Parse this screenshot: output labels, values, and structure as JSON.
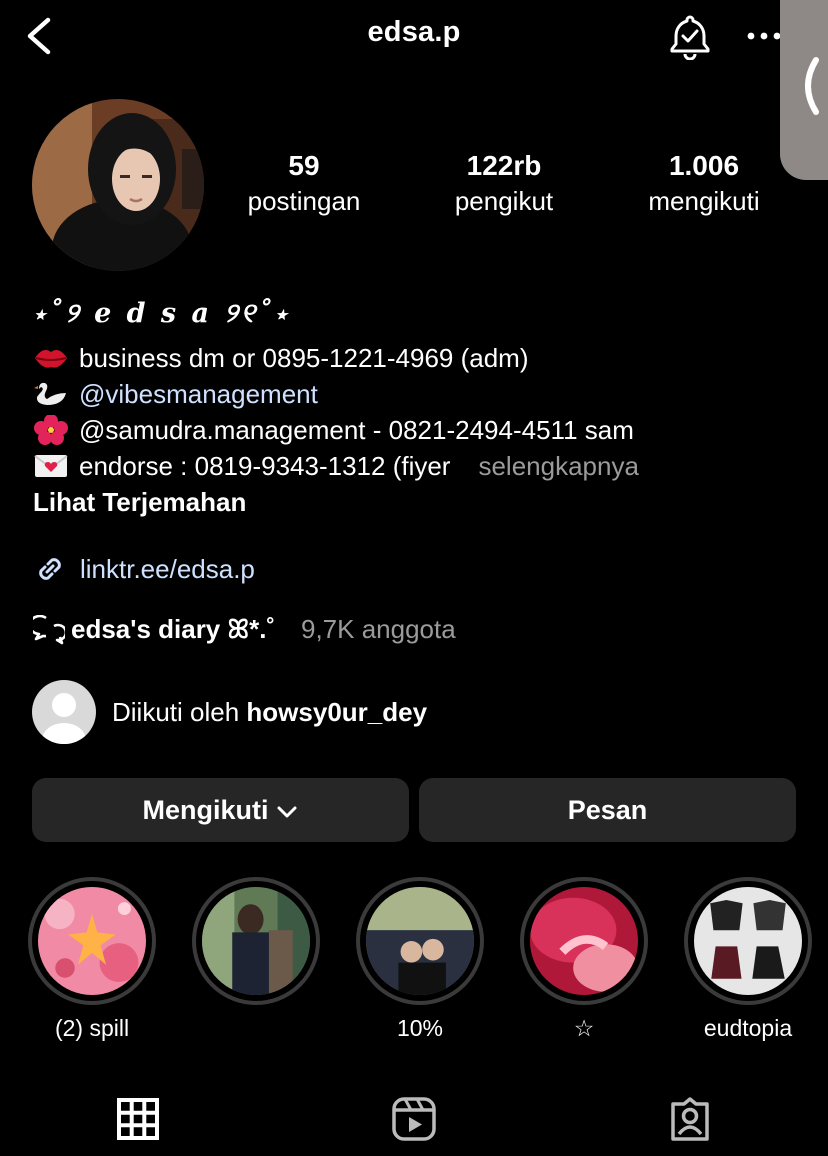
{
  "header": {
    "username": "edsa.p",
    "icons": [
      "back-chevron-icon",
      "notification-bell-check-icon",
      "more-dots-icon",
      "side-panel-chevron-icon"
    ]
  },
  "stats": [
    {
      "value": "59",
      "label": "postingan"
    },
    {
      "value": "122rb",
      "label": "pengikut"
    },
    {
      "value": "1.006",
      "label": "mengikuti"
    }
  ],
  "bio": {
    "display_name": "⋆˚୨ e d s a ୨୧˚⋆",
    "lines": [
      {
        "icon": "lips-emoji",
        "text": "business dm or 0895-1221-4969 (adm)"
      },
      {
        "icon": "swan-emoji",
        "text": "@vibesmanagement"
      },
      {
        "icon": "hibiscus-emoji",
        "text": "@samudra.management - 0821-2494-4511 sam"
      },
      {
        "icon": "love-letter-emoji",
        "text": "endorse : 0819-9343-1312 (fiyer"
      }
    ],
    "more_label": "selengkapnya",
    "translate_label": "Lihat Terjemahan"
  },
  "link": {
    "icon": "link-icon",
    "text": "linktr.ee/edsa.p"
  },
  "channel": {
    "icon": "chat-bubbles-icon",
    "name": "edsa's diary ꕤ*.˚",
    "members": "9,7K anggota"
  },
  "followed_by": {
    "prefix": "Diikuti oleh ",
    "username": "howsy0ur_dey"
  },
  "buttons": {
    "following": "Mengikuti",
    "message": "Pesan"
  },
  "highlights": [
    {
      "caption": "(2) spill"
    },
    {
      "caption": ""
    },
    {
      "caption": "10%"
    },
    {
      "caption": "☆"
    },
    {
      "caption": "eudtopia"
    }
  ],
  "tabs": [
    {
      "icon": "grid-icon"
    },
    {
      "icon": "reels-icon"
    },
    {
      "icon": "tagged-person-icon"
    }
  ],
  "colors": {
    "background": "#000000",
    "button": "#262626",
    "secondary_text": "#9b9b9b",
    "link_text": "#cfe1ff",
    "highlight_ring": "#3a3a3a"
  }
}
